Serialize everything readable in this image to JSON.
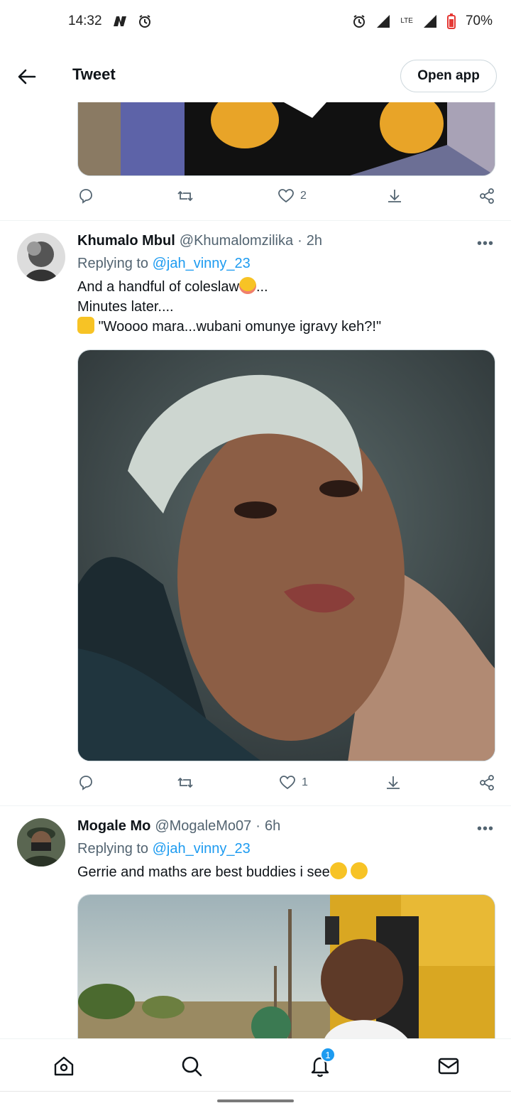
{
  "status_bar": {
    "time": "14:32",
    "network": "LTE",
    "battery": "70%"
  },
  "header": {
    "title": "Tweet",
    "open_app_label": "Open app"
  },
  "first_tweet": {
    "like_count": "2"
  },
  "tweets": [
    {
      "name": "Khumalo Mbul",
      "handle": "@Khumalomzilika",
      "separator": "·",
      "time": "2h",
      "replying_prefix": "Replying to",
      "replying_to": "@jah_vinny_23",
      "lines": [
        "And a handful of coleslaw",
        "...",
        "Minutes later....",
        "\"Woooo mara...wubani omunye igravy keh?!\""
      ],
      "like_count": "1"
    },
    {
      "name": "Mogale Mo",
      "handle": "@MogaleMo07",
      "separator": "·",
      "time": "6h",
      "replying_prefix": "Replying to",
      "replying_to": "@jah_vinny_23",
      "lines": [
        "Gerrie and maths are best buddies i see"
      ]
    }
  ],
  "more_label": "•••",
  "notifications_badge": "1",
  "colors": {
    "accent": "#1d9bf0",
    "secondary_text": "#536471",
    "border": "#cfd9de"
  }
}
